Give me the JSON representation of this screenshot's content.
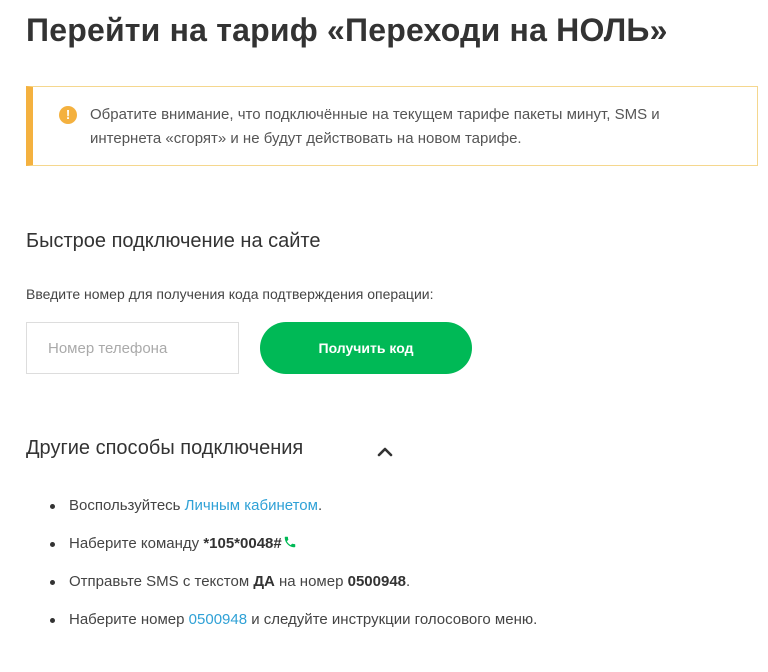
{
  "header": {
    "title": "Перейти на тариф «Переходи на НОЛЬ»"
  },
  "notice": {
    "icon": "info-icon",
    "icon_glyph": "!",
    "text": "Обратите внимание, что подключённые на текущем тарифе пакеты минут, SMS и интернета «сгорят» и не будут действовать на новом тарифе.",
    "accent_color": "#f4b13f"
  },
  "quick_connect": {
    "title": "Быстрое подключение на сайте",
    "hint": "Введите номер для получения кода подтверждения операции:",
    "phone_input": {
      "value": "",
      "placeholder": "Номер телефона"
    },
    "button_label": "Получить код",
    "button_color": "#00b956"
  },
  "other_methods": {
    "title": "Другие способы подключения",
    "toggle_icon": "chevron-up-icon",
    "items": [
      {
        "pre": "Воспользуйтесь ",
        "link": "Личным кабинетом",
        "post": "."
      },
      {
        "pre": "Наберите команду ",
        "code": "*105*0048#",
        "icon": "phone-icon"
      },
      {
        "pre": "Отправьте SMS с текстом ",
        "keyword": "ДА",
        "mid": " на номер ",
        "number": "0500948",
        "post": "."
      },
      {
        "pre": "Наберите номер ",
        "link": "0500948",
        "post": " и следуйте инструкции голосового меню."
      }
    ],
    "link_color": "#2fa1d6"
  }
}
